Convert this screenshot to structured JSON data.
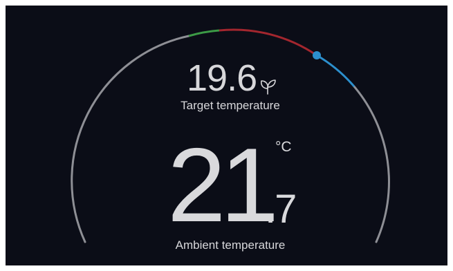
{
  "thermostat": {
    "target_temperature": "19.6",
    "target_label": "Target temperature",
    "ambient_integer": "21",
    "ambient_decimal": ".7",
    "unit": "°C",
    "ambient_label": "Ambient temperature",
    "eco_icon": "leaf-icon"
  },
  "colors": {
    "background": "#0b0d17",
    "track": "#8e8f95",
    "comfort_green": "#3c9a46",
    "heating_red": "#a3262e",
    "cooling_blue": "#2c8fcd",
    "text": "#d7d7da"
  }
}
